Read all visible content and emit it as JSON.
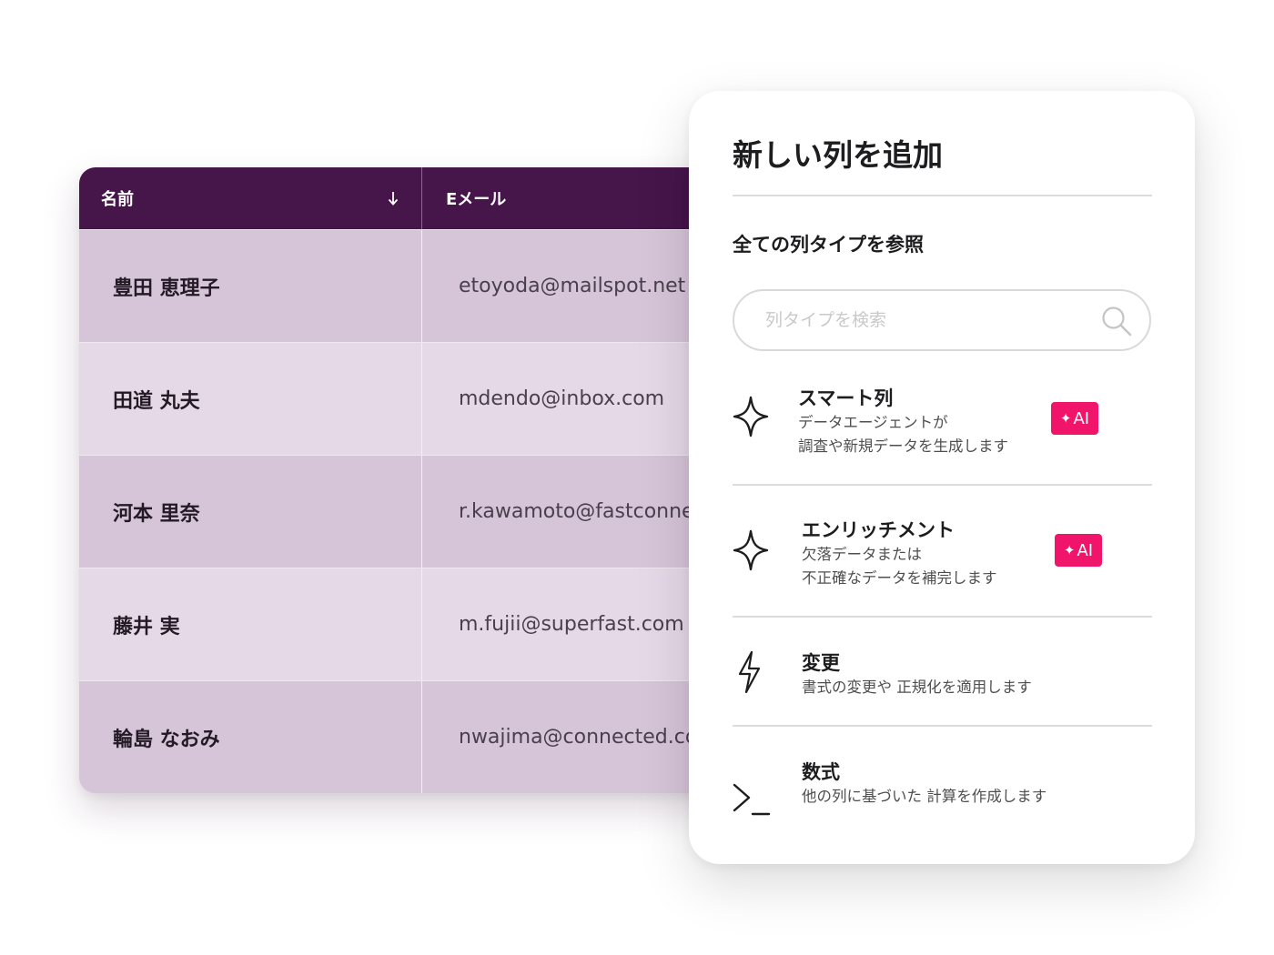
{
  "table": {
    "headers": {
      "name": "名前",
      "email": "Eメール"
    },
    "sort_direction": "descending",
    "rows": [
      {
        "name": "豊田 恵理子",
        "email": "etoyoda@mailspot.net"
      },
      {
        "name": "田道 丸夫",
        "email": "mdendo@inbox.com"
      },
      {
        "name": "河本 里奈",
        "email": "r.kawamoto@fastconnect"
      },
      {
        "name": "藤井 実",
        "email": "m.fujii@superfast.com"
      },
      {
        "name": "輪島 なおみ",
        "email": "nwajima@connected.co"
      }
    ],
    "colors": {
      "header_bg": "#46154a",
      "row_dark": "#d6c4d9",
      "row_light": "#e5d8e7"
    }
  },
  "panel": {
    "title": "新しい列を追加",
    "browse_label": "全ての列タイプを参照",
    "search": {
      "placeholder": "列タイプを検索",
      "value": ""
    },
    "options": [
      {
        "icon": "sparkle-icon",
        "title": "スマート列",
        "desc_line1": "データエージェントが",
        "desc_line2": "調査や新規データを生成します",
        "badge": "AI"
      },
      {
        "icon": "sparkle-icon",
        "title": "エンリッチメント",
        "desc_line1": "欠落データまたは",
        "desc_line2": "不正確なデータを補完します",
        "badge": "AI"
      },
      {
        "icon": "lightning-icon",
        "title": "変更",
        "desc_line1": "書式の変更や 正規化を適用します"
      },
      {
        "icon": "terminal-icon",
        "title": "数式",
        "desc_line1": "他の列に基づいた 計算を作成します"
      }
    ],
    "colors": {
      "ai_badge": "#f0146b"
    }
  }
}
